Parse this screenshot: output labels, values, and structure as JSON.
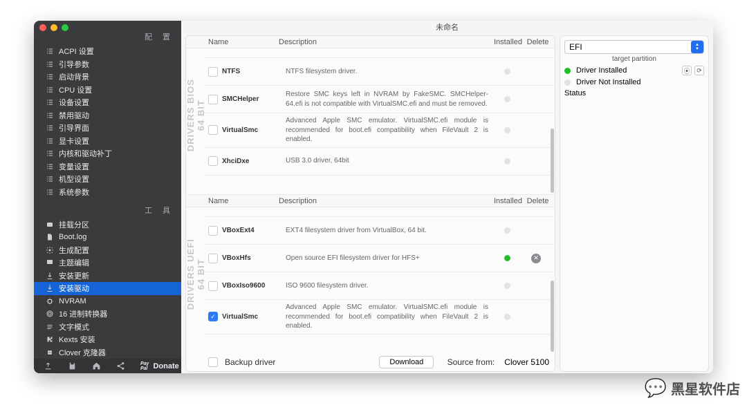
{
  "window": {
    "title": "未命名"
  },
  "sidebar": {
    "config_label": "配 置",
    "tools_label": "工 具",
    "items_config": [
      {
        "icon": "list",
        "label": "ACPI 设置"
      },
      {
        "icon": "list",
        "label": "引导参数"
      },
      {
        "icon": "list",
        "label": "启动背景"
      },
      {
        "icon": "list",
        "label": "CPU 设置"
      },
      {
        "icon": "list",
        "label": "设备设置"
      },
      {
        "icon": "list",
        "label": "禁用驱动"
      },
      {
        "icon": "list",
        "label": "引导界面"
      },
      {
        "icon": "list",
        "label": "显卡设置"
      },
      {
        "icon": "list",
        "label": "内核和驱动补丁"
      },
      {
        "icon": "list",
        "label": "变量设置"
      },
      {
        "icon": "list",
        "label": "机型设置"
      },
      {
        "icon": "list",
        "label": "系统参数"
      }
    ],
    "items_tools": [
      {
        "icon": "disk",
        "label": "挂载分区"
      },
      {
        "icon": "doc",
        "label": "Boot.log"
      },
      {
        "icon": "gear",
        "label": "生成配置"
      },
      {
        "icon": "theme",
        "label": "主题编辑"
      },
      {
        "icon": "dl",
        "label": "安装更新"
      },
      {
        "icon": "dl",
        "label": "安装驱动",
        "active": true
      },
      {
        "icon": "chip",
        "label": "NVRAM"
      },
      {
        "icon": "hex",
        "label": "16 进制转换器"
      },
      {
        "icon": "txt",
        "label": "文字模式"
      },
      {
        "icon": "puzzle",
        "label": "Kexts 安装"
      },
      {
        "icon": "clover",
        "label": "Clover 克隆器"
      }
    ],
    "donate": "Donate",
    "paypal1": "Pay",
    "paypal2": "Pal"
  },
  "headers": {
    "name": "Name",
    "description": "Description",
    "installed": "Installed",
    "delete": "Delete"
  },
  "section_bios": {
    "label": "DRIVERS BIOS 64 BIT",
    "rows": [
      {
        "name": "",
        "desc": "",
        "installed": "none",
        "truncated": true
      },
      {
        "name": "NTFS",
        "desc": "NTFS filesystem driver.",
        "installed": "none"
      },
      {
        "name": "SMCHelper",
        "desc": "Restore SMC keys left in NVRAM by FakeSMC. SMCHelper-64.efi is not compatible with VirtualSMC.efi and must be removed.",
        "installed": "none"
      },
      {
        "name": "VirtualSmc",
        "desc": "Advanced Apple SMC emulator. VirtualSMC.efi module is recommended for boot.efi compatibility when FileVault 2 is enabled.",
        "installed": "none"
      },
      {
        "name": "XhciDxe",
        "desc": "USB 3.0 driver, 64bit",
        "installed": "none"
      }
    ]
  },
  "section_uefi": {
    "label": "DRIVERS UEFI 64 BIT",
    "rows": [
      {
        "name": "",
        "desc": "",
        "installed": "none",
        "truncated": true
      },
      {
        "name": "VBoxExt4",
        "desc": "EXT4 filesystem driver from VirtualBox, 64 bit.",
        "installed": "none"
      },
      {
        "name": "VBoxHfs",
        "desc": "Open source EFI filesystem driver for HFS+",
        "installed": "ok",
        "deletable": true
      },
      {
        "name": "VBoxIso9600",
        "desc": "ISO 9600 filesystem driver.",
        "installed": "none"
      },
      {
        "name": "VirtualSmc",
        "desc": "Advanced Apple SMC emulator. VirtualSMC.efi module is recommended for boot.efi compatibility when FileVault 2 is enabled.",
        "installed": "none",
        "checked": true
      }
    ]
  },
  "footer": {
    "backup": "Backup driver",
    "download": "Download",
    "source_label": "Source from:",
    "source_value": "Clover 5100"
  },
  "right": {
    "partition_value": "EFI",
    "partition_label": "target partition",
    "installed_label": "Driver Installed",
    "notinstalled_label": "Driver Not Installed",
    "status_label": "Status"
  },
  "watermark": "黑星软件店"
}
